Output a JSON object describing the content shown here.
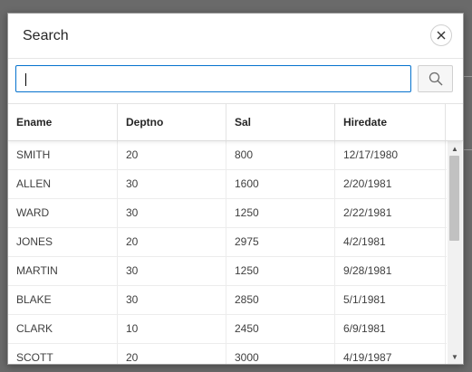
{
  "dialog": {
    "title": "Search",
    "close_icon": "close-icon",
    "search_icon": "search-icon"
  },
  "search": {
    "value": "",
    "placeholder": ""
  },
  "table": {
    "columns": [
      "Ename",
      "Deptno",
      "Sal",
      "Hiredate"
    ],
    "rows": [
      [
        "SMITH",
        "20",
        "800",
        "12/17/1980"
      ],
      [
        "ALLEN",
        "30",
        "1600",
        "2/20/1981"
      ],
      [
        "WARD",
        "30",
        "1250",
        "2/22/1981"
      ],
      [
        "JONES",
        "20",
        "2975",
        "4/2/1981"
      ],
      [
        "MARTIN",
        "30",
        "1250",
        "9/28/1981"
      ],
      [
        "BLAKE",
        "30",
        "2850",
        "5/1/1981"
      ],
      [
        "CLARK",
        "10",
        "2450",
        "6/9/1981"
      ],
      [
        "SCOTT",
        "20",
        "3000",
        "4/19/1987"
      ]
    ]
  },
  "colors": {
    "accent": "#0572ce",
    "backdrop": "#6a6a6a"
  }
}
